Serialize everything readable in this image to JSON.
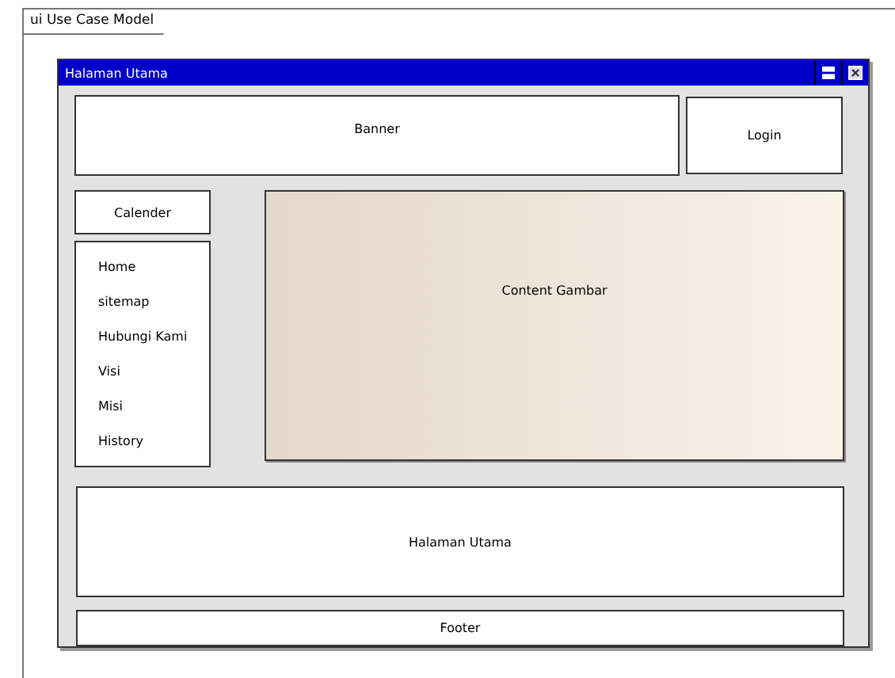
{
  "diagram": {
    "label": "ui Use Case Model"
  },
  "window": {
    "title": "Halaman Utama"
  },
  "banner": {
    "label": "Banner"
  },
  "login": {
    "label": "Login"
  },
  "calendar": {
    "label": "Calender"
  },
  "menu": {
    "items": [
      "Home",
      "sitemap",
      "Hubungi Kami",
      "Visi",
      "Misi",
      "History"
    ]
  },
  "content": {
    "label": "Content Gambar"
  },
  "main_area": {
    "label": "Halaman Utama"
  },
  "footer": {
    "label": "Footer"
  }
}
